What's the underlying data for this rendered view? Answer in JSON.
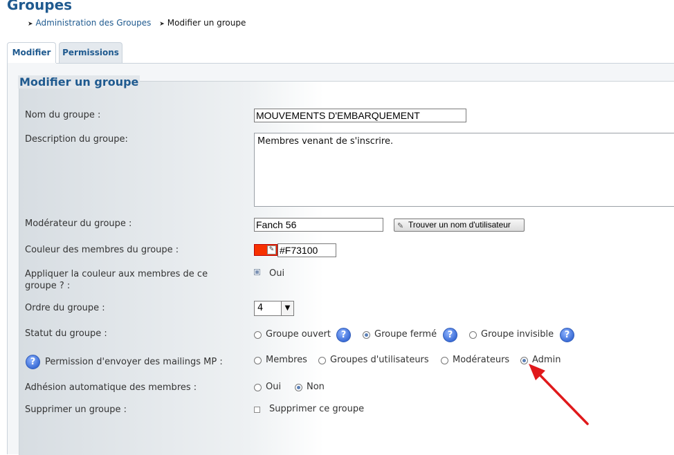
{
  "page": {
    "title": "Groupes"
  },
  "breadcrumb": [
    {
      "label": "Administration des Groupes"
    },
    {
      "label": "Modifier un groupe"
    }
  ],
  "tabs": [
    {
      "label": "Modifier",
      "active": true
    },
    {
      "label": "Permissions",
      "active": false
    }
  ],
  "form": {
    "legend": "Modifier un groupe",
    "group_name": {
      "label": "Nom du groupe :",
      "value": "MOUVEMENTS D'EMBARQUEMENT"
    },
    "description": {
      "label": "Description du groupe:",
      "value": "Membres venant de s'inscrire."
    },
    "moderator": {
      "label": "Modérateur du groupe :",
      "value": "Fanch 56",
      "button_label": "Trouver un nom d'utilisateur"
    },
    "color": {
      "label": "Couleur des membres du groupe :",
      "value": "#F73100",
      "swatch": "#f73100"
    },
    "apply_color": {
      "label": "Appliquer la couleur aux membres de ce groupe ? :",
      "option_label": "Oui",
      "checked": true
    },
    "order": {
      "label": "Ordre du groupe :",
      "value": "4"
    },
    "status": {
      "label": "Statut du groupe :",
      "options": [
        {
          "label": "Groupe ouvert",
          "selected": false
        },
        {
          "label": "Groupe fermé",
          "selected": true
        },
        {
          "label": "Groupe invisible",
          "selected": false
        }
      ]
    },
    "mailing": {
      "label": "Permission d'envoyer des mailings MP :",
      "options": [
        {
          "label": "Membres",
          "selected": false
        },
        {
          "label": "Groupes d'utilisateurs",
          "selected": false
        },
        {
          "label": "Modérateurs",
          "selected": false
        },
        {
          "label": "Admin",
          "selected": true
        }
      ]
    },
    "auto_join": {
      "label": "Adhésion automatique des membres :",
      "options": [
        {
          "label": "Oui",
          "selected": false
        },
        {
          "label": "Non",
          "selected": true
        }
      ]
    },
    "delete": {
      "label": "Supprimer un groupe :",
      "option_label": "Supprimer ce groupe",
      "checked": false
    }
  },
  "icons": {
    "help": "help-icon",
    "picker": "color-picker-icon",
    "pencil": "pencil-icon",
    "annotation": "red-arrow-annotation"
  },
  "colors": {
    "title": "#1f5a8f",
    "annotation_arrow": "#e0191b"
  }
}
